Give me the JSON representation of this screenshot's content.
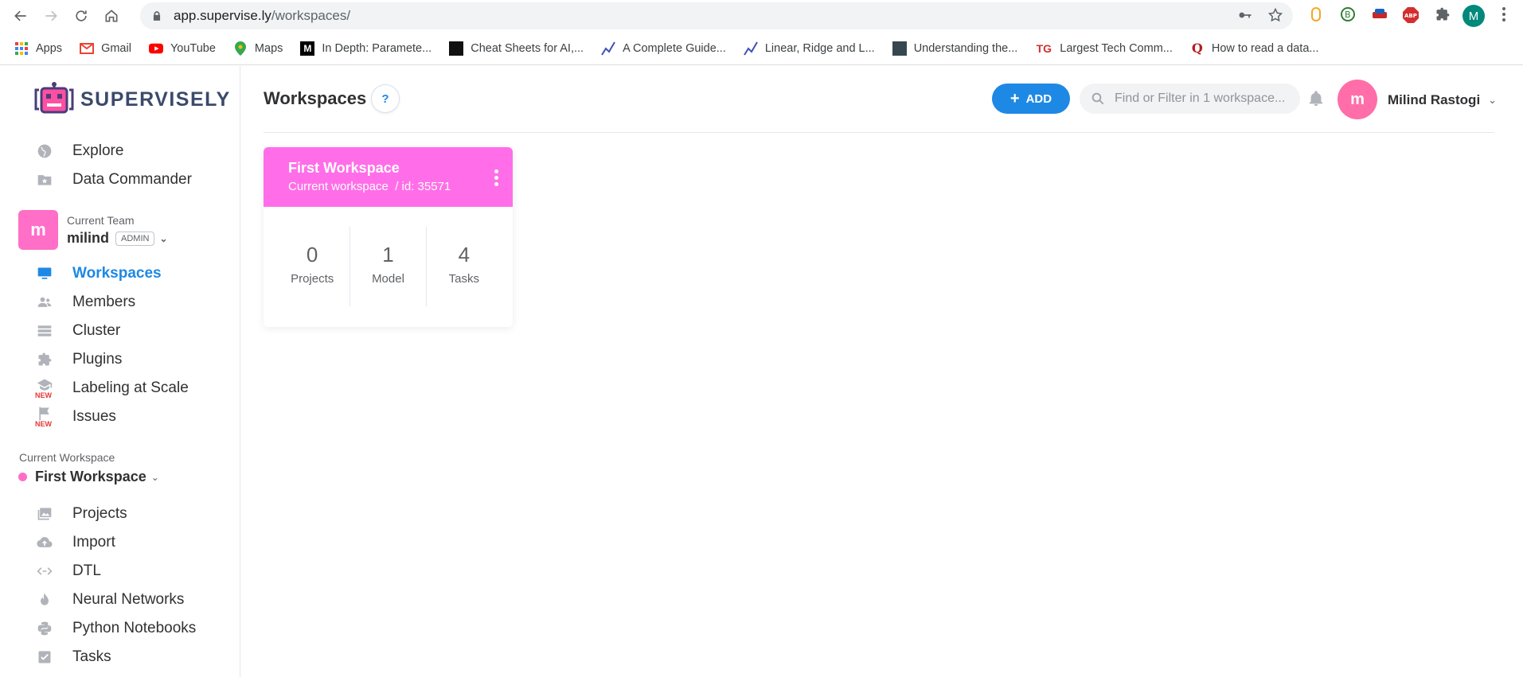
{
  "browser": {
    "url_host": "app.supervise.ly",
    "url_path": "/workspaces/",
    "profile_initial": "M"
  },
  "bookmarks": [
    {
      "label": "Apps",
      "icon": "apps-grid-icon"
    },
    {
      "label": "Gmail",
      "icon": "gmail-icon"
    },
    {
      "label": "YouTube",
      "icon": "youtube-icon"
    },
    {
      "label": "Maps",
      "icon": "maps-icon"
    },
    {
      "label": "In Depth: Paramete...",
      "icon": "medium-icon"
    },
    {
      "label": "Cheat Sheets for AI,...",
      "icon": "cheatsheet-icon"
    },
    {
      "label": "A Complete Guide...",
      "icon": "chart-icon"
    },
    {
      "label": "Linear, Ridge and L...",
      "icon": "chart-icon"
    },
    {
      "label": "Understanding the...",
      "icon": "article-icon"
    },
    {
      "label": "Largest Tech Comm...",
      "icon": "tg-icon"
    },
    {
      "label": "How to read a data...",
      "icon": "quora-icon"
    }
  ],
  "sidebar": {
    "logo_text": "SUPERVISELY",
    "top_items": [
      {
        "label": "Explore",
        "icon": "globe-icon"
      },
      {
        "label": "Data Commander",
        "icon": "folder-star-icon"
      }
    ],
    "team": {
      "avatar_initial": "m",
      "caption": "Current Team",
      "name": "milind",
      "role_badge": "ADMIN"
    },
    "team_items": [
      {
        "label": "Workspaces",
        "icon": "monitor-icon",
        "active": true
      },
      {
        "label": "Members",
        "icon": "people-icon"
      },
      {
        "label": "Cluster",
        "icon": "server-icon"
      },
      {
        "label": "Plugins",
        "icon": "puzzle-icon"
      },
      {
        "label": "Labeling at Scale",
        "icon": "graduation-cap-icon",
        "new": "NEW"
      },
      {
        "label": "Issues",
        "icon": "flag-icon",
        "new": "NEW"
      }
    ],
    "workspace": {
      "caption": "Current Workspace",
      "name": "First Workspace"
    },
    "workspace_items": [
      {
        "label": "Projects",
        "icon": "images-icon"
      },
      {
        "label": "Import",
        "icon": "cloud-upload-icon"
      },
      {
        "label": "DTL",
        "icon": "code-arrows-icon"
      },
      {
        "label": "Neural Networks",
        "icon": "flame-icon"
      },
      {
        "label": "Python Notebooks",
        "icon": "python-icon"
      },
      {
        "label": "Tasks",
        "icon": "checkbox-icon"
      }
    ]
  },
  "header": {
    "title": "Workspaces",
    "help_label": "?",
    "add_label": "ADD",
    "search_placeholder": "Find or Filter in 1 workspace...",
    "user_initial": "m",
    "user_name": "Milind Rastogi"
  },
  "workspace_card": {
    "title": "First Workspace",
    "subtitle": "Current workspace  / id: 35571",
    "color": "#ff6ee8",
    "stats": [
      {
        "value": "0",
        "label": "Projects"
      },
      {
        "value": "1",
        "label": "Model"
      },
      {
        "value": "4",
        "label": "Tasks"
      }
    ]
  }
}
